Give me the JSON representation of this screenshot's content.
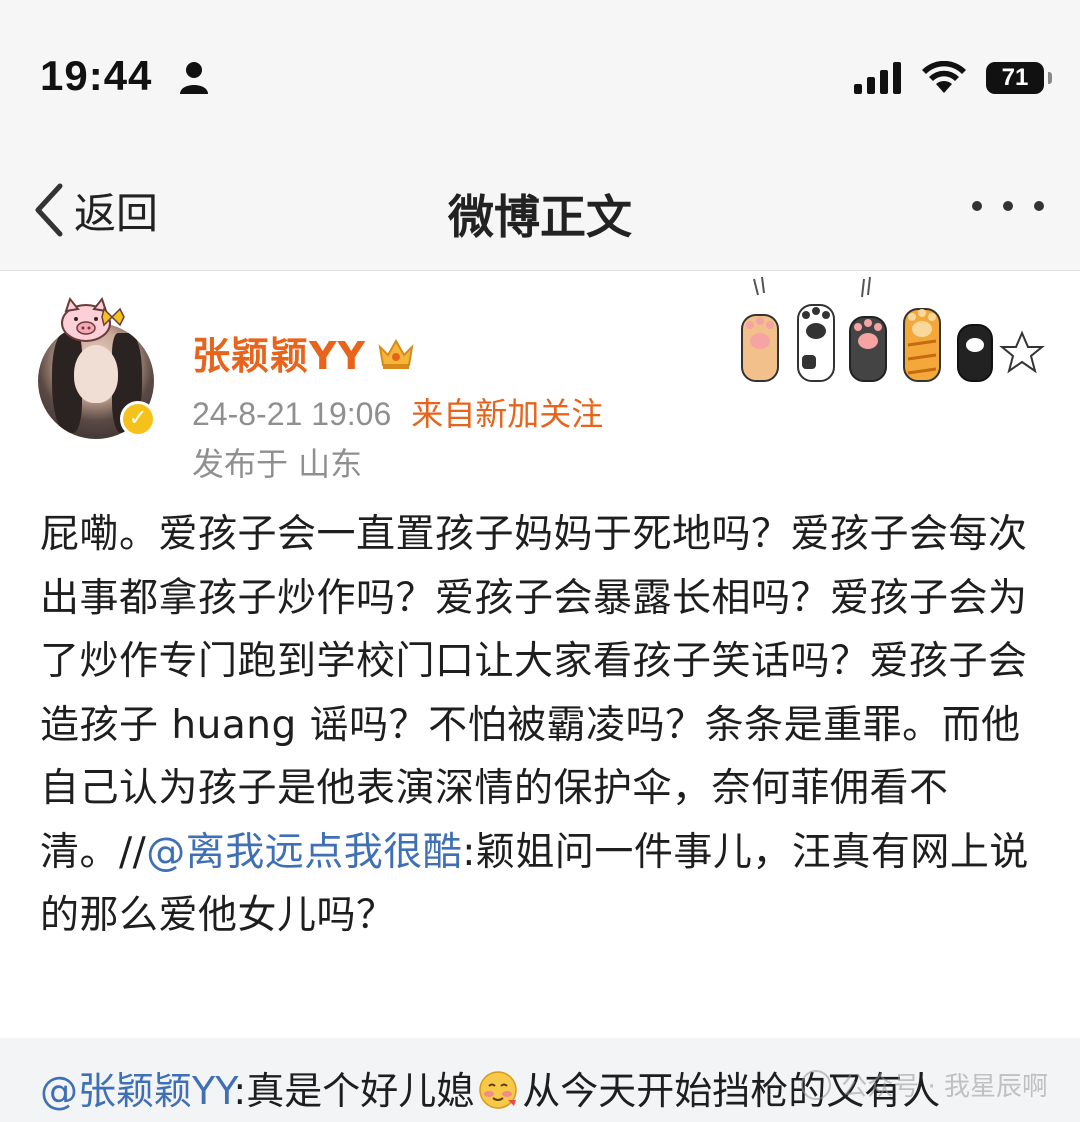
{
  "status_bar": {
    "time": "19:44",
    "battery": "71",
    "icons": [
      "person-icon",
      "signal-icon",
      "wifi-icon",
      "battery-icon"
    ]
  },
  "nav": {
    "back_label": "返回",
    "title": "微博正文",
    "more_icon": "more-dots-icon"
  },
  "post": {
    "author": "张颖颖YY",
    "author_icon": "crown-icon",
    "verified_icon": "verified-check-icon",
    "time": "24-8-21 19:06",
    "source": "来自新加关注",
    "location": "发布于 山东",
    "decoration": "cat-paws-sticker",
    "body_text": "屁嘞。爱孩子会一直置孩子妈妈于死地吗？爱孩子会每次出事都拿孩子炒作吗？爱孩子会暴露长相吗？爱孩子会为了炒作专门跑到学校门口让大家看孩子笑话吗？爱孩子会造孩子 huang 谣吗？不怕被霸凌吗？条条是重罪。而他自己认为孩子是他表演深情的保护伞，奈何菲佣看不清。//",
    "quoted_mention": "@离我远点我很酷",
    "quoted_text": ":颖姐问一件事儿，汪真有网上说的那么爱他女儿吗？"
  },
  "repost": {
    "mention": "@张颖颖YY",
    "text_before_emoji": ":真是个好儿媳",
    "emoji": "blushing-face-emoji",
    "text_after_emoji": "从今天开始挡枪的又有人",
    "watermark": "公众号 · 我星辰啊"
  },
  "colors": {
    "accent_orange": "#e8631b",
    "mention_blue": "#3f6fb5",
    "meta_gray": "#8f8f8f",
    "topbar_bg": "#f6f6f6",
    "repost_bg": "#f3f4f6"
  }
}
